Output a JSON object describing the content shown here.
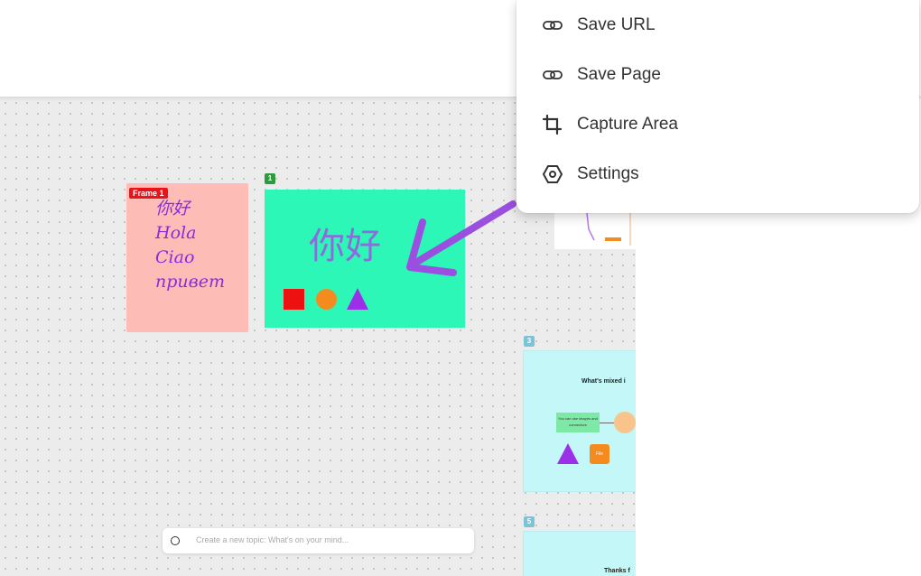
{
  "menu": {
    "items": [
      {
        "label": "Save URL",
        "icon": "link-icon"
      },
      {
        "label": "Save Page",
        "icon": "link-icon"
      },
      {
        "label": "Capture Area",
        "icon": "crop-icon"
      },
      {
        "label": "Settings",
        "icon": "hexagon-settings-icon"
      }
    ]
  },
  "canvas": {
    "frame1": {
      "tag": "Frame 1",
      "lines": [
        "你好",
        "Hola",
        "Ciao",
        "привет"
      ]
    },
    "frame_green": {
      "badge": "1",
      "text": "你好"
    },
    "thumbnails": [
      {
        "badge": "3",
        "title": "What's mixed i",
        "note_text": "You can use shapes and connectors",
        "cylinder_label": "File"
      },
      {
        "badge": "5",
        "title": "Thanks f"
      }
    ],
    "topic_input": {
      "placeholder": "Create a new topic: What's on your mind..."
    }
  },
  "colors": {
    "accent_purple": "#8a2be2",
    "frame_pink": "#fdbcb6",
    "frame_green": "#2cf7b6",
    "frame_tag_red": "#e8141b",
    "thumb_cyan": "#c4f7f7"
  }
}
